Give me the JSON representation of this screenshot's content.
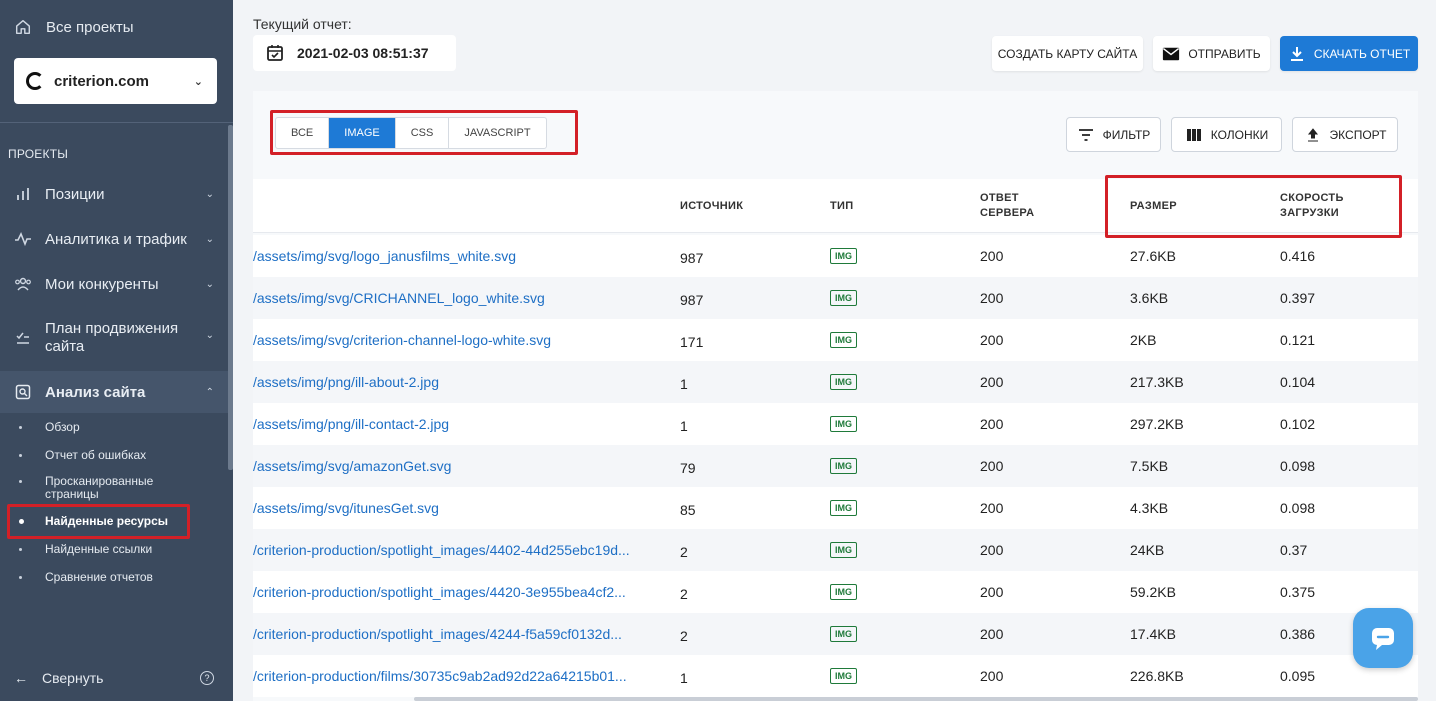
{
  "sidebar": {
    "all_projects": "Все проекты",
    "project": "criterion.com",
    "section_title": "ПРОЕКТЫ",
    "nav": [
      {
        "label": "Позиции",
        "icon": "bar-chart-icon"
      },
      {
        "label": "Аналитика и трафик",
        "icon": "pulse-icon"
      },
      {
        "label": "Мои конкуренты",
        "icon": "users-icon"
      },
      {
        "label": "План продвижения сайта",
        "icon": "checklist-icon"
      },
      {
        "label": "Анализ сайта",
        "icon": "site-audit-icon"
      }
    ],
    "sub": [
      "Обзор",
      "Отчет об ошибках",
      "Просканированные страницы",
      "Найденные ресурсы",
      "Найденные ссылки",
      "Сравнение отчетов"
    ],
    "collapse": "Свернуть",
    "help": "?"
  },
  "header": {
    "report_label": "Текущий отчет:",
    "report_date": "2021-02-03 08:51:37",
    "sitemap_btn": "СОЗДАТЬ КАРТУ САЙТА",
    "send_btn": "ОТПРАВИТЬ",
    "download_btn": "СКАЧАТЬ ОТЧЕТ"
  },
  "toolbar": {
    "tabs": [
      "ВСЕ",
      "IMAGE",
      "CSS",
      "JAVASCRIPT"
    ],
    "active_tab": "IMAGE",
    "filter": "ФИЛЬТР",
    "columns": "КОЛОНКИ",
    "export": "ЭКСПОРТ"
  },
  "table": {
    "headers": {
      "source": "ИСТОЧНИК",
      "type": "ТИП",
      "status": "ОТВЕТ СЕРВЕРА",
      "size": "РАЗМЕР",
      "speed": "СКОРОСТЬ ЗАГРУЗКИ"
    },
    "rows": [
      {
        "url": "/assets/img/svg/logo_janusfilms_white.svg",
        "source": "987",
        "type": "IMG",
        "status": "200",
        "size": "27.6KB",
        "speed": "0.416"
      },
      {
        "url": "/assets/img/svg/CRICHANNEL_logo_white.svg",
        "source": "987",
        "type": "IMG",
        "status": "200",
        "size": "3.6KB",
        "speed": "0.397"
      },
      {
        "url": "/assets/img/svg/criterion-channel-logo-white.svg",
        "source": "171",
        "type": "IMG",
        "status": "200",
        "size": "2KB",
        "speed": "0.121"
      },
      {
        "url": "/assets/img/png/ill-about-2.jpg",
        "source": "1",
        "type": "IMG",
        "status": "200",
        "size": "217.3KB",
        "speed": "0.104"
      },
      {
        "url": "/assets/img/png/ill-contact-2.jpg",
        "source": "1",
        "type": "IMG",
        "status": "200",
        "size": "297.2KB",
        "speed": "0.102"
      },
      {
        "url": "/assets/img/svg/amazonGet.svg",
        "source": "79",
        "type": "IMG",
        "status": "200",
        "size": "7.5KB",
        "speed": "0.098"
      },
      {
        "url": "/assets/img/svg/itunesGet.svg",
        "source": "85",
        "type": "IMG",
        "status": "200",
        "size": "4.3KB",
        "speed": "0.098"
      },
      {
        "url": "/criterion-production/spotlight_images/4402-44d255ebc19d...",
        "source": "2",
        "type": "IMG",
        "status": "200",
        "size": "24KB",
        "speed": "0.37"
      },
      {
        "url": "/criterion-production/spotlight_images/4420-3e955bea4cf2...",
        "source": "2",
        "type": "IMG",
        "status": "200",
        "size": "59.2KB",
        "speed": "0.375"
      },
      {
        "url": "/criterion-production/spotlight_images/4244-f5a59cf0132d...",
        "source": "2",
        "type": "IMG",
        "status": "200",
        "size": "17.4KB",
        "speed": "0.386"
      },
      {
        "url": "/criterion-production/films/30735c9ab2ad92d22a64215b01...",
        "source": "1",
        "type": "IMG",
        "status": "200",
        "size": "226.8KB",
        "speed": "0.095"
      }
    ]
  },
  "colors": {
    "sidebar_bg": "#3b4a5e",
    "accent": "#1e7ad6",
    "link": "#1e6fc5",
    "highlight": "#d32027",
    "badge": "#1f7a3a",
    "chat": "#4aa3e8"
  }
}
